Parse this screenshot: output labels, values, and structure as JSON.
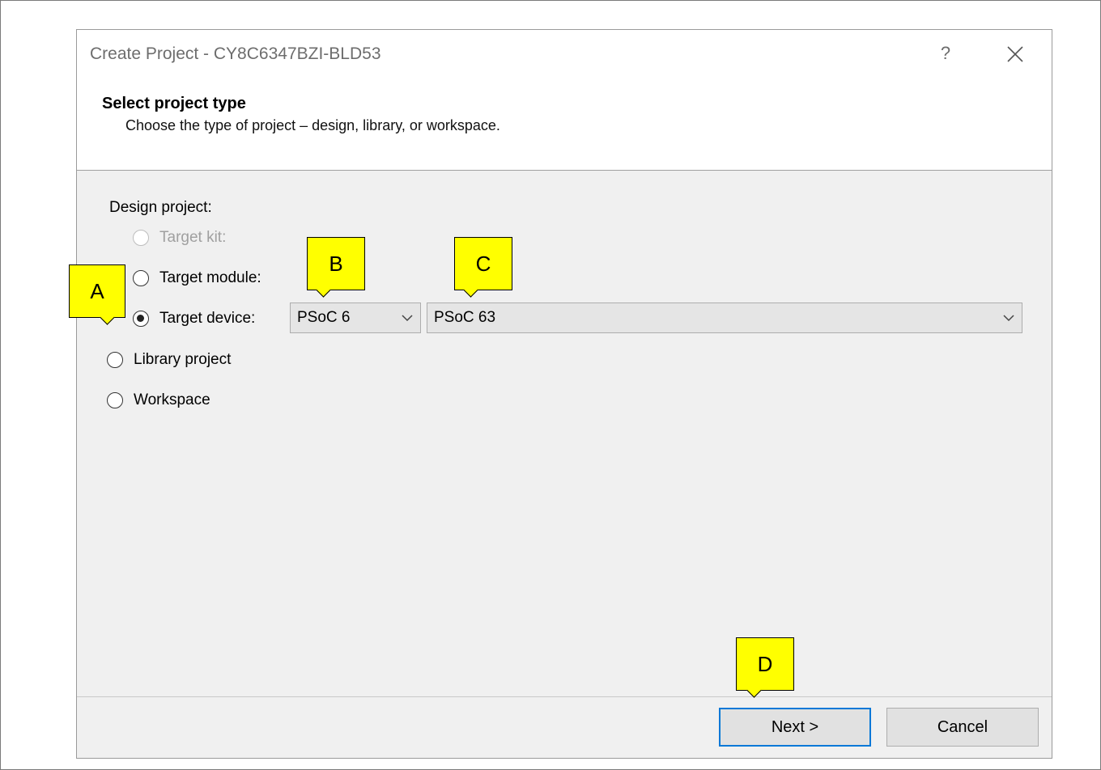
{
  "dialog": {
    "title": "Create Project - CY8C6347BZI-BLD53",
    "help_glyph": "?",
    "section_title": "Select project type",
    "section_desc": "Choose the type of project – design, library, or workspace."
  },
  "options": {
    "group_label": "Design project:",
    "target_kit": "Target kit:",
    "target_module": "Target module:",
    "target_device": "Target device:",
    "library_project": "Library project",
    "workspace": "Workspace",
    "selected": "Target device"
  },
  "dropdowns": {
    "family": "PSoC 6",
    "series": "PSoC 63"
  },
  "buttons": {
    "next": "Next >",
    "cancel": "Cancel"
  },
  "callouts": {
    "a": "A",
    "b": "B",
    "c": "C",
    "d": "D"
  },
  "colors": {
    "callout": "#ffff00",
    "default_button_border": "#0078d7",
    "dialog_bg": "#f0f0f0"
  }
}
